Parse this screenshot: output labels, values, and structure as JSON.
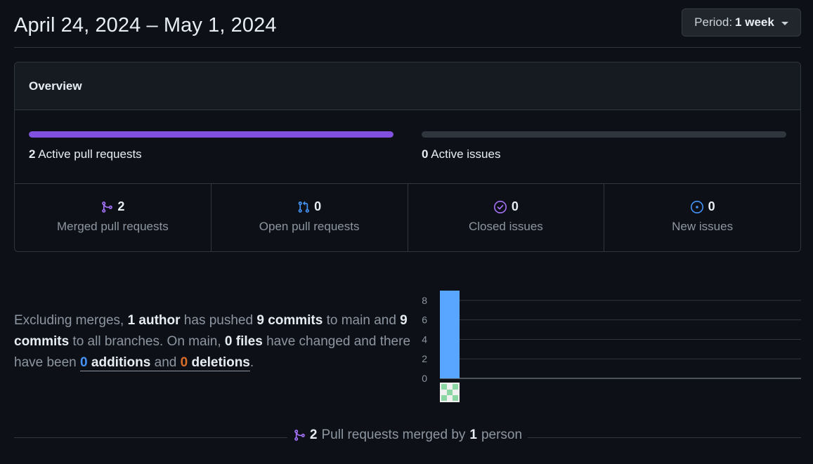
{
  "header": {
    "title": "April 24, 2024 – May 1, 2024",
    "period_label": "Period:",
    "period_value": "1 week"
  },
  "overview": {
    "title": "Overview",
    "pull_requests": {
      "count": "2",
      "label": "Active pull requests",
      "fill_fraction": 1.0,
      "color": "#8250df"
    },
    "issues": {
      "count": "0",
      "label": "Active issues",
      "fill_fraction": 0.0
    },
    "stats": [
      {
        "icon": "git-merge-icon",
        "value": "2",
        "label": "Merged pull requests",
        "color": "#a371f7"
      },
      {
        "icon": "git-pull-request-icon",
        "value": "0",
        "label": "Open pull requests",
        "color": "#4493f8"
      },
      {
        "icon": "issue-closed-icon",
        "value": "0",
        "label": "Closed issues",
        "color": "#a371f7"
      },
      {
        "icon": "issue-opened-icon",
        "value": "0",
        "label": "New issues",
        "color": "#4493f8"
      }
    ]
  },
  "summary": {
    "t1": "Excluding merges, ",
    "authors": "1 author",
    "t2": " has pushed ",
    "commits_main": "9 commits",
    "t3": " to main and ",
    "commits_all": "9 commits",
    "t4": " to all branches. On main, ",
    "files": "0 files",
    "t5": " have changed and there have been ",
    "additions_count": "0",
    "additions_word": "additions",
    "and": " and ",
    "deletions_count": "0",
    "deletions_word": "deletions",
    "end": "."
  },
  "chart_data": {
    "type": "bar",
    "categories": [
      "author-avatar"
    ],
    "values": [
      9
    ],
    "ylim": [
      0,
      9
    ],
    "yticks": [
      0,
      2,
      4,
      6,
      8
    ],
    "bar_color": "#58a6ff",
    "grid": true
  },
  "merged_prs": {
    "count": "2",
    "t1": "Pull requests merged by",
    "people": "1",
    "t2": "person"
  }
}
